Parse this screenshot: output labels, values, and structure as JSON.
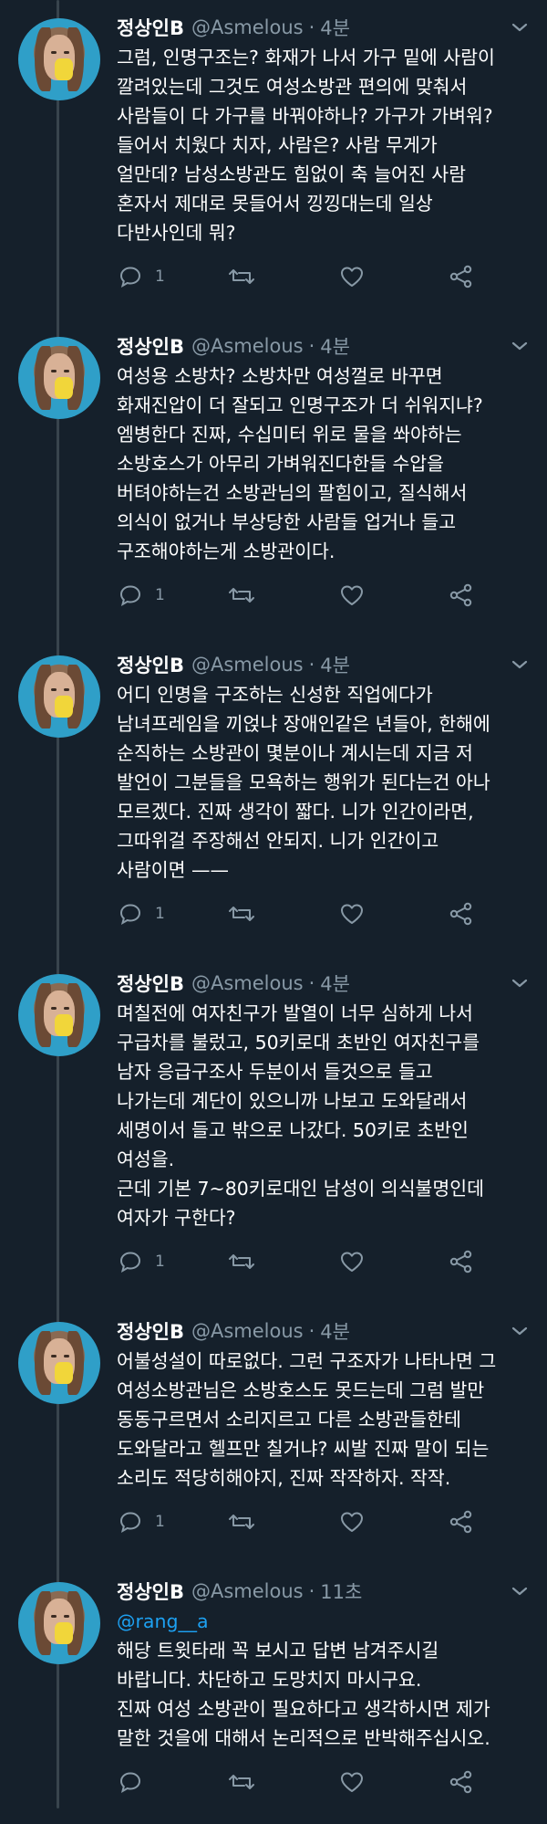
{
  "user": {
    "name": "정상인B",
    "handle": "@Asmelous",
    "separator": "·"
  },
  "colors": {
    "background": "#15202b",
    "muted": "#8899a6",
    "accent": "#1da1f2",
    "thread_line": "#38444d"
  },
  "tweets": [
    {
      "time": "4분",
      "lines": [
        "그럼, 인명구조는? 화재가 나서 가구 밑에 사람이",
        "깔려있는데 그것도 여성소방관 편의에 맞춰서",
        "사람들이 다 가구를 바꿔야하나? 가구가 가벼워?",
        "들어서 치웠다 치자, 사람은? 사람 무게가",
        "얼만데? 남성소방관도 힘없이 축 늘어진 사람",
        "혼자서 제대로 못들어서 낑낑대는데 일상",
        "다반사인데 뭐?"
      ],
      "reply_count": "1"
    },
    {
      "time": "4분",
      "lines": [
        "여성용 소방차? 소방차만 여성껄로 바꾸면",
        "화재진압이 더 잘되고 인명구조가 더 쉬워지냐?",
        "엠병한다 진짜, 수십미터 위로 물을 쏴야하는",
        "소방호스가 아무리 가벼워진다한들 수압을",
        "버텨야하는건 소방관님의 팔힘이고, 질식해서",
        "의식이 없거나 부상당한 사람들 업거나 들고",
        "구조해야하는게 소방관이다."
      ],
      "reply_count": "1"
    },
    {
      "time": "4분",
      "lines": [
        "어디 인명을 구조하는 신성한 직업에다가",
        "남녀프레임을 끼얹냐 장애인같은 년들아, 한해에",
        "순직하는 소방관이 몇분이나 계시는데 지금 저",
        "발언이 그분들을 모욕하는 행위가 된다는건 아나",
        "모르겠다. 진짜 생각이 짧다. 니가 인간이라면,",
        "그따위걸 주장해선 안되지. 니가 인간이고",
        "사람이면 ——"
      ],
      "reply_count": "1"
    },
    {
      "time": "4분",
      "lines": [
        "며칠전에 여자친구가 발열이 너무 심하게 나서",
        "구급차를 불렀고, 50키로대 초반인 여자친구를",
        "남자 응급구조사 두분이서 들것으로 들고",
        "나가는데 계단이 있으니까 나보고 도와달래서",
        "세명이서 들고 밖으로 나갔다. 50키로 초반인",
        "여성을.",
        "근데 기본 7~80키로대인 남성이 의식불명인데",
        "여자가 구한다?"
      ],
      "reply_count": "1"
    },
    {
      "time": "4분",
      "lines": [
        "어불성설이 따로없다. 그런 구조자가 나타나면 그",
        "여성소방관님은 소방호스도 못드는데 그럼 발만",
        "동동구르면서 소리지르고 다른 소방관들한테",
        "도와달라고 헬프만 칠거냐? 씨발 진짜 말이 되는",
        "소리도 적당히해야지, 진짜 작작하자. 작작."
      ],
      "reply_count": "1"
    },
    {
      "time": "11초",
      "mention": "@rang__a",
      "lines": [
        "해당 트윗타래 꼭 보시고 답변 남겨주시길",
        "바랍니다. 차단하고 도망치지 마시구요.",
        "진짜 여성 소방관이 필요하다고 생각하시면 제가",
        "말한 것을에 대해서 논리적으로 반박해주십시오."
      ],
      "reply_count": ""
    }
  ],
  "icons": {
    "reply": "reply-icon",
    "retweet": "retweet-icon",
    "like": "heart-icon",
    "share": "share-icon",
    "more": "chevron-down-icon"
  }
}
